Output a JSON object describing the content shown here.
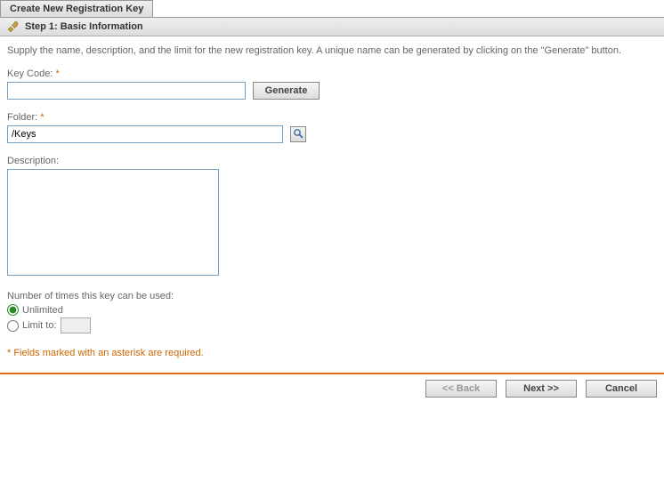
{
  "tab": {
    "title": "Create New Registration Key"
  },
  "step": {
    "title": "Step 1: Basic Information"
  },
  "instructions": "Supply the name, description, and the limit for the new registration key. A unique name can be generated by clicking on the \"Generate\" button.",
  "fields": {
    "keycode": {
      "label": "Key Code:",
      "required": "*",
      "value": "",
      "generate_label": "Generate"
    },
    "folder": {
      "label": "Folder:",
      "required": "*",
      "value": "/Keys"
    },
    "description": {
      "label": "Description:",
      "value": ""
    },
    "usage": {
      "label": "Number of times this key can be used:",
      "options": {
        "unlimited": "Unlimited",
        "limit_to": "Limit to:"
      },
      "limit_value": ""
    }
  },
  "footnote": "* Fields marked with an asterisk are required.",
  "footer": {
    "back": "<< Back",
    "next": "Next >>",
    "cancel": "Cancel"
  }
}
